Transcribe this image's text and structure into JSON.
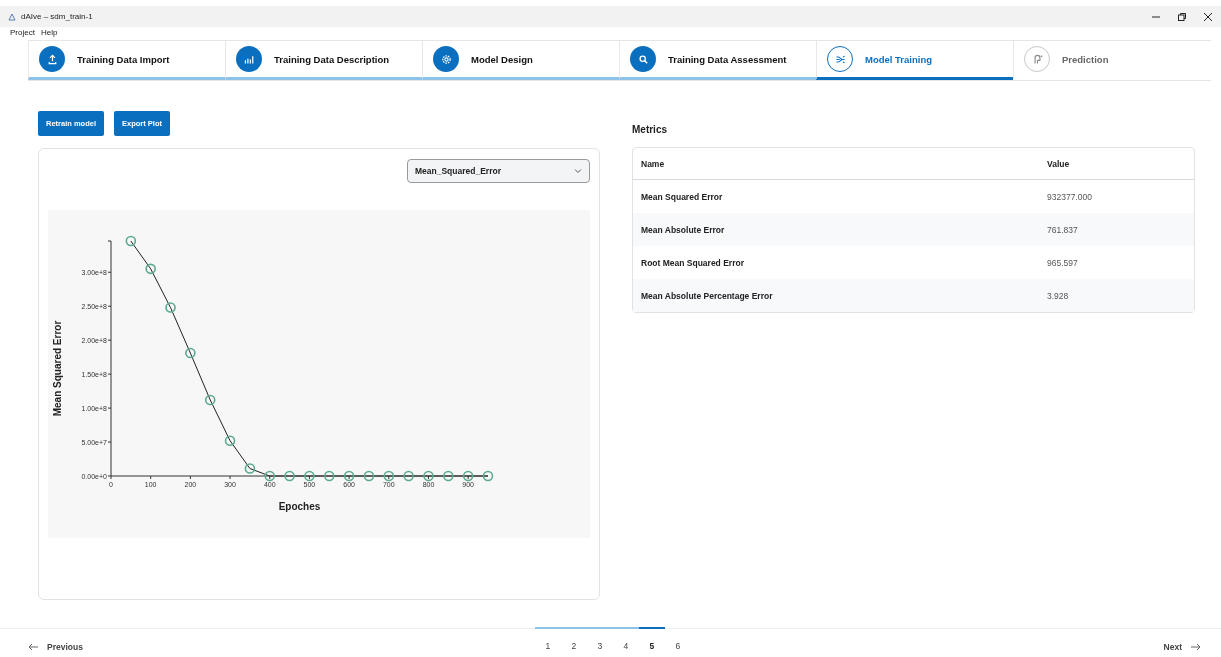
{
  "window": {
    "title": "dAIve – sdm_train-1"
  },
  "menu": [
    "Project",
    "Help"
  ],
  "steps": [
    {
      "label": "Training Data Import",
      "completed": true,
      "selected": false
    },
    {
      "label": "Training Data Description",
      "completed": true,
      "selected": false
    },
    {
      "label": "Model Design",
      "completed": true,
      "selected": false
    },
    {
      "label": "Training Data Assessment",
      "completed": true,
      "selected": false
    },
    {
      "label": "Model Training",
      "completed": false,
      "selected": true
    },
    {
      "label": "Prediction",
      "completed": false,
      "selected": false
    }
  ],
  "buttons": [
    "Retrain model",
    "Export Plot"
  ],
  "plot_panel": {
    "metric_select": {
      "value": "Mean_Squared_Error"
    },
    "chart_data": {
      "type": "line",
      "xlabel": "Epoches",
      "ylabel": "Mean Squared Error",
      "x": [
        50,
        100,
        150,
        200,
        250,
        300,
        350,
        400,
        450,
        500,
        550,
        600,
        650,
        700,
        750,
        800,
        850,
        900,
        950
      ],
      "series": [
        {
          "color": "#5aaa8f",
          "marker": "circle",
          "values": [
            346000000,
            305000000,
            248000000,
            181000000,
            112000000,
            52000000,
            11000000,
            0,
            0,
            0,
            0,
            0,
            0,
            0,
            0,
            0,
            0,
            0,
            0
          ]
        }
      ],
      "xlim": [
        0,
        950
      ],
      "ylim": [
        0,
        346000000
      ],
      "xticks": [
        0,
        100,
        200,
        300,
        400,
        500,
        600,
        700,
        800,
        900
      ],
      "yticks": [
        {
          "value": 0,
          "label": "0.00e+0"
        },
        {
          "value": 50000000,
          "label": "5.00e+7"
        },
        {
          "value": 100000000,
          "label": "1.00e+8"
        },
        {
          "value": 150000000,
          "label": "1.50e+8"
        },
        {
          "value": 200000000,
          "label": "2.00e+8"
        },
        {
          "value": 250000000,
          "label": "2.50e+8"
        },
        {
          "value": 300000000,
          "label": "3.00e+8"
        }
      ]
    }
  },
  "metrics": {
    "title": "Metrics",
    "columns": [
      "Name",
      "Value"
    ],
    "rows": [
      [
        "Mean Squared Error",
        "932377.000"
      ],
      [
        "Mean Absolute Error",
        "761.837"
      ],
      [
        "Root Mean Squared Error",
        "965.597"
      ],
      [
        "Mean Absolute Percentage Error",
        "3.928"
      ]
    ]
  },
  "footer": {
    "previous": "Previous",
    "next": "Next",
    "pages": [
      {
        "label": "1",
        "selected": false
      },
      {
        "label": "2",
        "selected": false
      },
      {
        "label": "3",
        "selected": false
      },
      {
        "label": "4",
        "selected": false
      },
      {
        "label": "5",
        "selected": true
      },
      {
        "label": "6",
        "selected": false
      }
    ]
  }
}
